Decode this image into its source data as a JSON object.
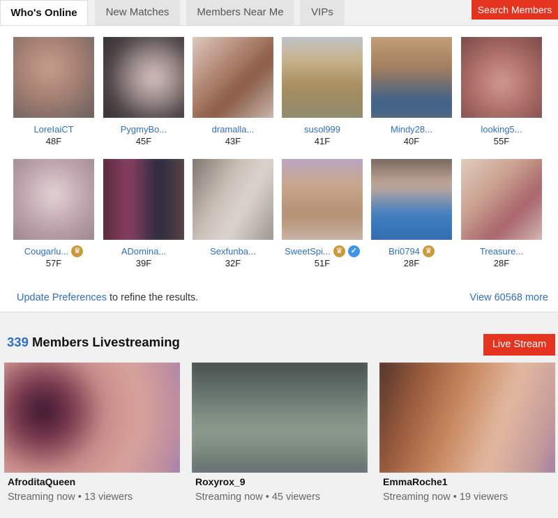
{
  "tabs": [
    {
      "label": "Who's Online",
      "active": true
    },
    {
      "label": "New Matches",
      "active": false
    },
    {
      "label": "Members Near Me",
      "active": false
    },
    {
      "label": "VIPs",
      "active": false
    }
  ],
  "search_button": "Search Members",
  "online": {
    "members": [
      {
        "username": "LoreIaiCT",
        "age": "48F",
        "crown": false,
        "verified": false
      },
      {
        "username": "PygmyBo...",
        "age": "45F",
        "crown": false,
        "verified": false
      },
      {
        "username": "dramalla...",
        "age": "43F",
        "crown": false,
        "verified": false
      },
      {
        "username": "susol999",
        "age": "41F",
        "crown": false,
        "verified": false
      },
      {
        "username": "Mindy28...",
        "age": "40F",
        "crown": false,
        "verified": false
      },
      {
        "username": "looking5...",
        "age": "55F",
        "crown": false,
        "verified": false
      },
      {
        "username": "Cougarlu...",
        "age": "57F",
        "crown": true,
        "verified": false
      },
      {
        "username": "ADomina...",
        "age": "39F",
        "crown": false,
        "verified": false
      },
      {
        "username": "Sexfunba...",
        "age": "32F",
        "crown": false,
        "verified": false
      },
      {
        "username": "SweetSpi...",
        "age": "51F",
        "crown": true,
        "verified": true
      },
      {
        "username": "Bri0794",
        "age": "28F",
        "crown": true,
        "verified": false
      },
      {
        "username": "Treasure...",
        "age": "28F",
        "crown": false,
        "verified": false
      }
    ],
    "update_link": "Update Preferences",
    "update_suffix": " to refine the results.",
    "view_more": "View 60568 more"
  },
  "livestream": {
    "count": "339",
    "title": " Members Livestreaming",
    "button": "Live Stream",
    "streams": [
      {
        "name": "AfroditaQueen",
        "status": "Streaming now • 13 viewers"
      },
      {
        "name": "Roxyrox_9",
        "status": "Streaming now • 45 viewers"
      },
      {
        "name": "EmmaRoche1",
        "status": "Streaming now • 19 viewers"
      }
    ]
  },
  "colors": {
    "accent_red": "#e43420",
    "link_blue": "#2f6fc5",
    "crown_gold": "#c99a3c",
    "verified_blue": "#3f95e8"
  }
}
